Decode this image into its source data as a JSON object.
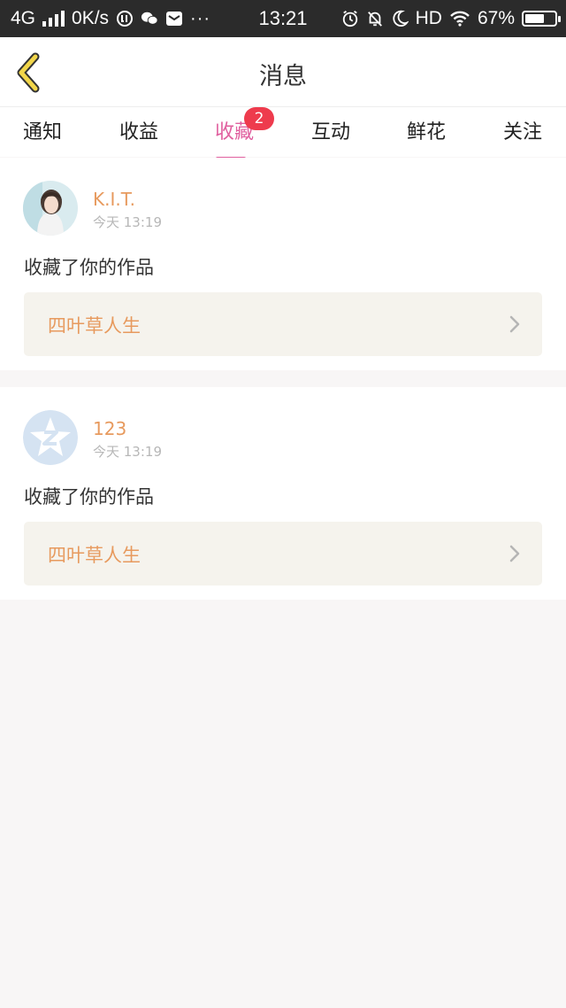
{
  "status_bar": {
    "network": "4G",
    "speed": "0K/s",
    "time": "13:21",
    "hd": "HD",
    "battery": "67%",
    "battery_level": 0.67,
    "icons": [
      "signal-icon",
      "data-saver-icon",
      "wechat-icon",
      "mail-icon",
      "more-dots-icon",
      "alarm-icon",
      "mute-icon",
      "moon-icon",
      "wifi-icon",
      "battery-icon"
    ]
  },
  "header": {
    "title": "消息",
    "back_icon": "chevron-left-icon"
  },
  "tabs": [
    {
      "label": "通知"
    },
    {
      "label": "收益"
    },
    {
      "label": "收藏",
      "badge": "2",
      "active": true
    },
    {
      "label": "互动"
    },
    {
      "label": "鲜花"
    },
    {
      "label": "关注"
    }
  ],
  "messages": [
    {
      "user": "K.I.T.",
      "time": "今天 13:19",
      "action": "收藏了你的作品",
      "work": "四叶草人生"
    },
    {
      "user": "123",
      "time": "今天 13:19",
      "action": "收藏了你的作品",
      "work": "四叶草人生"
    }
  ],
  "colors": {
    "accent_pink": "#e0609f",
    "name_orange": "#e79a5e",
    "badge_red": "#ee3b4d",
    "back_yellow": "#f2d64a",
    "work_bg": "#f5f3ed",
    "page_bg": "#f8f6f6"
  }
}
